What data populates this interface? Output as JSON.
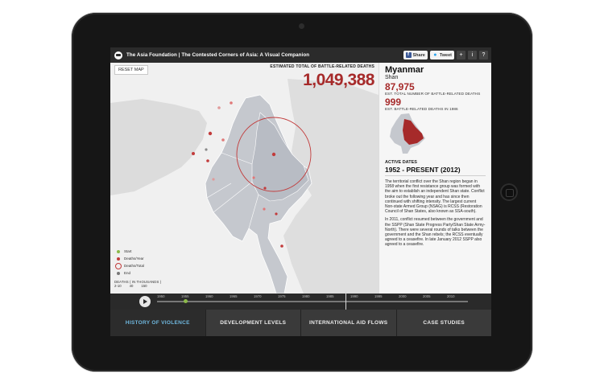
{
  "header": {
    "title": "The Asia Foundation | The Contested Corners of Asia: A Visual Companion",
    "facebook_label": "Share",
    "twitter_label": "Tweet",
    "plus_label": "+",
    "info_label": "i",
    "help_label": "?"
  },
  "map": {
    "reset_label": "RESET MAP",
    "total_label": "ESTIMATED TOTAL OF BATTLE-RELATED DEATHS",
    "total_value": "1,049,388",
    "legend": {
      "start": "Start",
      "per_year": "Deaths/Year",
      "total": "Deaths/Total",
      "end": "End",
      "scale_label": "DEATHS ( IN THOUSANDS )",
      "scale_values": [
        "2-10",
        "40",
        "150"
      ]
    },
    "colors": {
      "land": "#c9ccd2",
      "neighbor": "#d8d8d8",
      "accent": "#a62a2a",
      "start": "#8cb94a"
    }
  },
  "panel": {
    "country": "Myanmar",
    "region": "Shan",
    "total_deaths": "87,975",
    "total_deaths_label": "EST. TOTAL NUMBER OF BATTLE-RELATED DEATHS",
    "year_deaths": "999",
    "year_deaths_label": "EST. BATTLE-RELATED DEATHS IN 1986",
    "active_label": "ACTIVE DATES",
    "active_dates": "1952 - PRESENT (2012)",
    "paragraph1": "The territorial conflict over the Shan region began in 1958 when the first resistance group was formed with the aim to establish an independent Shan state. Conflict broke out the following year and has since then continued with shifting intensity. The largest current Non-state Armed Group (NSAG) is RCSS (Restoration Council of Shan States, also known as SSA-south).",
    "paragraph2": "In 2011, conflict resumed between the government and the SSPP (Shan State Progress Party/Shan State Army- North). There were several rounds of talks between the government and the Shan rebels; the RCSS eventually agreed to a ceasefire. In late January 2012 SSPP also agreed to a ceasefire."
  },
  "timeline": {
    "years": [
      "1950",
      "1955",
      "1960",
      "1965",
      "1970",
      "1975",
      "1980",
      "1985",
      "1990",
      "1995",
      "2000",
      "2005",
      "2010"
    ],
    "current_year": "1986"
  },
  "tabs": [
    {
      "label": "HISTORY OF VIOLENCE",
      "active": true
    },
    {
      "label": "DEVELOPMENT LEVELS",
      "active": false
    },
    {
      "label": "INTERNATIONAL AID FLOWS",
      "active": false
    },
    {
      "label": "CASE STUDIES",
      "active": false
    }
  ]
}
